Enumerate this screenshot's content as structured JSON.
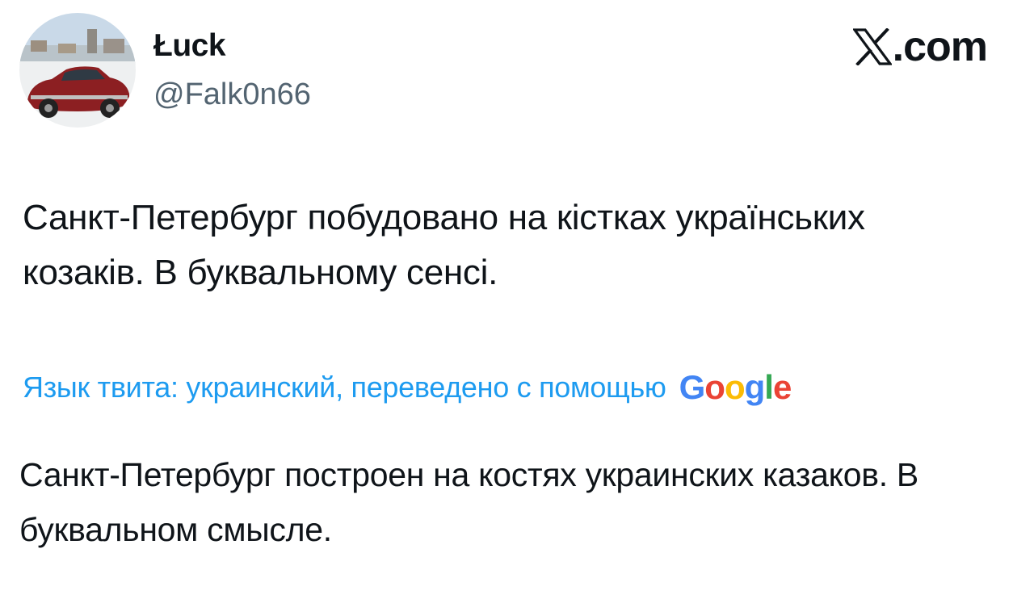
{
  "author": {
    "display_name": "Łuck",
    "handle": "@Falk0n66",
    "avatar_icon": "red-vintage-car-avatar"
  },
  "brand": {
    "x_icon": "x-logo-icon",
    "suffix": ".com"
  },
  "tweet": {
    "text": "Санкт-Петербург побудовано на кістках українських козаків. В буквальному сенсі."
  },
  "translation": {
    "label": "Язык твита: украинский, переведено с помощью",
    "provider_letters": [
      "G",
      "o",
      "o",
      "g",
      "l",
      "e"
    ],
    "text": "Санкт-Петербург построен на костях украинских казаков. В буквальном смысле."
  },
  "colors": {
    "link": "#1d9bf0",
    "text": "#0f1419",
    "secondary": "#536471",
    "google_blue": "#4285f4",
    "google_red": "#ea4335",
    "google_yellow": "#fbbc05",
    "google_green": "#34a853"
  }
}
